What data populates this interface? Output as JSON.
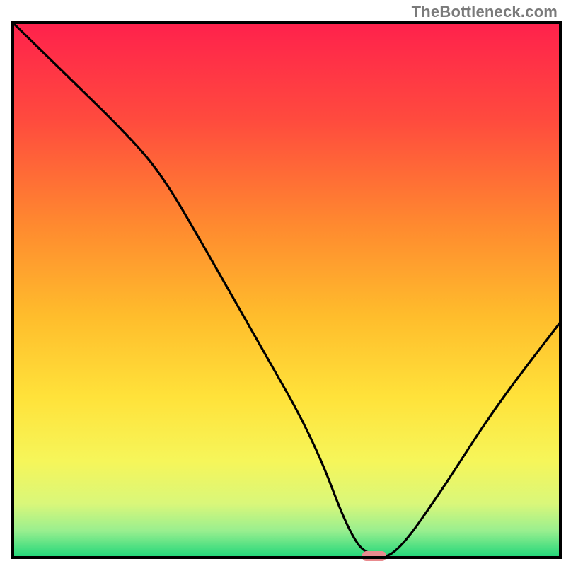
{
  "watermark": "TheBottleneck.com",
  "chart_data": {
    "type": "line",
    "title": "",
    "xlabel": "",
    "ylabel": "",
    "xlim": [
      0,
      100
    ],
    "ylim": [
      0,
      100
    ],
    "note": "Values read from a V-shaped bottleneck curve plotted over a red→green vertical gradient. Axes are unlabeled; x and y given in percent of plot span. y=100 at top, y=0 at bottom. The curve descends from top-left, kinks near x≈27, continues down to a short flat minimum around x≈62–70 at y≈0, then rises to roughly y≈44 at the right edge. A small pink marker sits at the minimum.",
    "x": [
      0,
      10,
      20,
      27,
      35,
      45,
      55,
      62,
      66,
      70,
      78,
      88,
      100
    ],
    "y": [
      100,
      90,
      80,
      72,
      58,
      40,
      22,
      3,
      0,
      0.5,
      12,
      28,
      44
    ],
    "minimum_marker": {
      "x": 66,
      "y": 0
    },
    "gradient_stops": [
      {
        "pct": 0,
        "color": "#ff214c"
      },
      {
        "pct": 18,
        "color": "#ff4a3e"
      },
      {
        "pct": 38,
        "color": "#ff8a2f"
      },
      {
        "pct": 55,
        "color": "#ffbd2c"
      },
      {
        "pct": 70,
        "color": "#ffe23a"
      },
      {
        "pct": 82,
        "color": "#f6f65a"
      },
      {
        "pct": 90,
        "color": "#d9f77a"
      },
      {
        "pct": 95,
        "color": "#99ef8f"
      },
      {
        "pct": 100,
        "color": "#1fd67a"
      }
    ],
    "marker_color": "#e98b8f",
    "curve_color": "#000000",
    "frame_color": "#000000"
  }
}
